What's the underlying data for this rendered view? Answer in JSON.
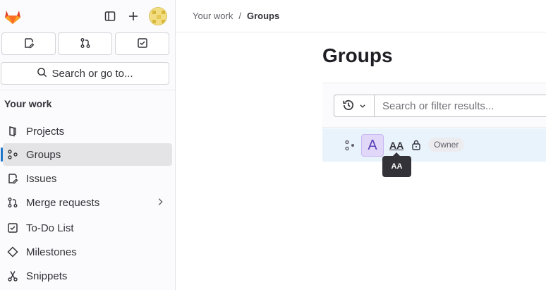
{
  "sidebar": {
    "search_label": "Search or go to...",
    "section_title": "Your work",
    "items": [
      {
        "label": "Projects",
        "icon": "project-icon"
      },
      {
        "label": "Groups",
        "icon": "group-icon",
        "active": true
      },
      {
        "label": "Issues",
        "icon": "issues-icon"
      },
      {
        "label": "Merge requests",
        "icon": "merge-request-icon"
      },
      {
        "label": "To-Do List",
        "icon": "todo-icon"
      },
      {
        "label": "Milestones",
        "icon": "milestone-icon"
      },
      {
        "label": "Snippets",
        "icon": "snippet-icon"
      }
    ]
  },
  "breadcrumb": {
    "parent": "Your work",
    "separator": "/",
    "current": "Groups"
  },
  "main": {
    "title": "Groups",
    "filter_placeholder": "Search or filter results..."
  },
  "group_row": {
    "avatar_letter": "A",
    "name": "AA",
    "role": "Owner",
    "tooltip": "AA"
  },
  "colors": {
    "accent": "#1f75cb",
    "logo": "#fc6d26",
    "row_bg": "#e9f3fc"
  }
}
